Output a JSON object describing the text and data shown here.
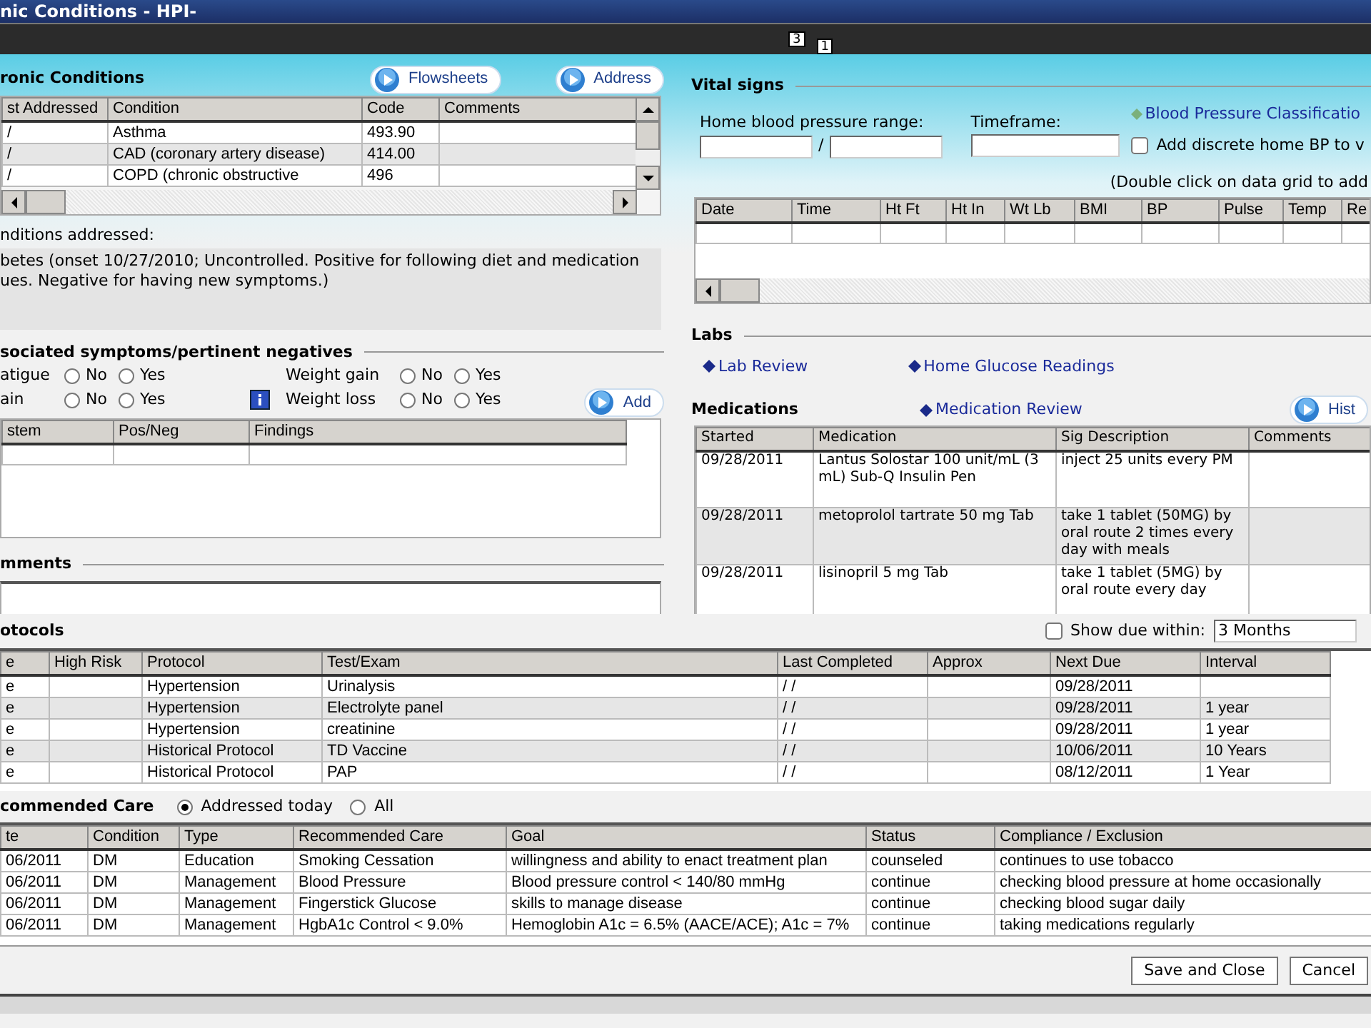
{
  "window": {
    "title": "nic Conditions - HPI-"
  },
  "toolbar_badges": [
    "3",
    "1"
  ],
  "chronic_conditions": {
    "title": "ronic Conditions",
    "buttons": [
      "Flowsheets",
      "Address"
    ],
    "columns": [
      "st Addressed",
      "Condition",
      "Code",
      "Comments"
    ],
    "rows": [
      {
        "addressed": "/",
        "condition": "Asthma",
        "code": "493.90"
      },
      {
        "addressed": "/",
        "condition": "CAD (coronary artery disease)",
        "code": "414.00"
      },
      {
        "addressed": "/",
        "condition": "COPD (chronic obstructive",
        "code": "496"
      }
    ]
  },
  "conditions_addressed": {
    "label": "nditions addressed:",
    "lines": [
      "betes (onset 10/27/2010; Uncontrolled. Positive for following diet and medication",
      "ues. Negative for having new symptoms.)"
    ]
  },
  "symptoms": {
    "title": "sociated symptoms/pertinent negatives",
    "items": [
      {
        "label": "atigue",
        "info": false,
        "options": [
          {
            "label": "No",
            "selected": false
          },
          {
            "label": "Yes",
            "selected": false
          }
        ]
      },
      {
        "label": "Weight gain",
        "info": false,
        "options": [
          {
            "label": "No",
            "selected": false
          },
          {
            "label": "Yes",
            "selected": false
          }
        ]
      },
      {
        "label": "ain",
        "info": false,
        "options": [
          {
            "label": "No",
            "selected": false
          },
          {
            "label": "Yes",
            "selected": false
          }
        ]
      },
      {
        "label": "Weight loss",
        "info": true,
        "options": [
          {
            "label": "No",
            "selected": false
          },
          {
            "label": "Yes",
            "selected": false
          }
        ]
      }
    ],
    "add_button": "Add",
    "columns": [
      "stem",
      "Pos/Neg",
      "Findings"
    ]
  },
  "comments": {
    "title": "mments"
  },
  "vital_signs": {
    "title": "Vital signs",
    "bp_range_label": "Home blood pressure range:",
    "separator": "/",
    "timeframe_label": "Timeframe:",
    "classification_link": "Blood Pressure Classificatio",
    "add_discrete": {
      "label": "Add discrete home BP to v",
      "checked": false
    },
    "hint": "(Double click on data grid to add",
    "columns": [
      "Date",
      "Time",
      "Ht Ft",
      "Ht In",
      "Wt Lb",
      "BMI",
      "BP",
      "Pulse",
      "Temp",
      "Re"
    ]
  },
  "labs": {
    "title": "Labs",
    "links": [
      "Lab Review",
      "Home Glucose Readings"
    ]
  },
  "medications": {
    "title": "Medications",
    "review_link": "Medication Review",
    "history_button": "Hist",
    "columns": [
      "Started",
      "Medication",
      "Sig Description",
      "Comments"
    ],
    "rows": [
      {
        "started": "09/28/2011",
        "medication": "Lantus Solostar 100 unit/mL (3 mL) Sub-Q Insulin Pen",
        "sig": "inject 25 units every PM"
      },
      {
        "started": "09/28/2011",
        "medication": "metoprolol tartrate 50 mg Tab",
        "sig": "take 1 tablet (50MG) by oral route 2 times every day with meals"
      },
      {
        "started": "09/28/2011",
        "medication": "lisinopril 5 mg Tab",
        "sig": "take 1 tablet (5MG) by oral route  every day"
      }
    ]
  },
  "protocols": {
    "title": "otocols",
    "show_due": {
      "label": "Show due within:",
      "checked": false,
      "value": "3 Months"
    },
    "columns": [
      "e",
      "High Risk",
      "Protocol",
      "Test/Exam",
      "Last Completed",
      "Approx",
      "Next Due",
      "Interval"
    ],
    "rows": [
      {
        "column_1": "e",
        "protocol": "Hypertension",
        "test": "Urinalysis",
        "last_completed": "/ /",
        "next_due": "09/28/2011"
      },
      {
        "column_1": "e",
        "protocol": "Hypertension",
        "test": "Electrolyte panel",
        "last_completed": "/ /",
        "next_due": "09/28/2011",
        "interval": "1 year"
      },
      {
        "column_1": "e",
        "protocol": "Hypertension",
        "test": "creatinine",
        "last_completed": "/ /",
        "next_due": "09/28/2011",
        "interval": "1 year"
      },
      {
        "column_1": "e",
        "protocol": "Historical Protocol",
        "test": "TD Vaccine",
        "last_completed": "/ /",
        "next_due": "10/06/2011",
        "interval": "10 Years"
      },
      {
        "column_1": "e",
        "protocol": "Historical Protocol",
        "test": "PAP",
        "last_completed": "/ /",
        "next_due": "08/12/2011",
        "interval": "1 Year"
      }
    ]
  },
  "recommended_care": {
    "title": "commended Care",
    "filter": [
      {
        "label": "Addressed today",
        "selected": true
      },
      {
        "label": "All",
        "selected": false
      }
    ],
    "columns": [
      "te",
      "Condition",
      "Type",
      "Recommended Care",
      "Goal",
      "Status",
      "Compliance / Exclusion"
    ],
    "rows": [
      {
        "date": "06/2011",
        "condition": "DM",
        "type": "Education",
        "care": "Smoking Cessation",
        "goal": "willingness and ability to enact treatment plan",
        "status": "counseled",
        "compliance": "continues to use tobacco"
      },
      {
        "date": "06/2011",
        "condition": "DM",
        "type": "Management",
        "care": "Blood Pressure",
        "goal": "Blood pressure control < 140/80 mmHg",
        "status": "continue",
        "compliance": "checking  blood pressure at home occasionally"
      },
      {
        "date": "06/2011",
        "condition": "DM",
        "type": "Management",
        "care": "Fingerstick Glucose",
        "goal": "skills to manage disease",
        "status": "continue",
        "compliance": "checking blood sugar daily"
      },
      {
        "date": "06/2011",
        "condition": "DM",
        "type": "Management",
        "care": "HgbA1c Control < 9.0%",
        "goal": "Hemoglobin A1c = 6.5% (AACE/ACE); A1c = 7%",
        "status": "continue",
        "compliance": "taking medications regularly"
      }
    ]
  },
  "buttons": [
    "Save and Close",
    "Cancel"
  ]
}
